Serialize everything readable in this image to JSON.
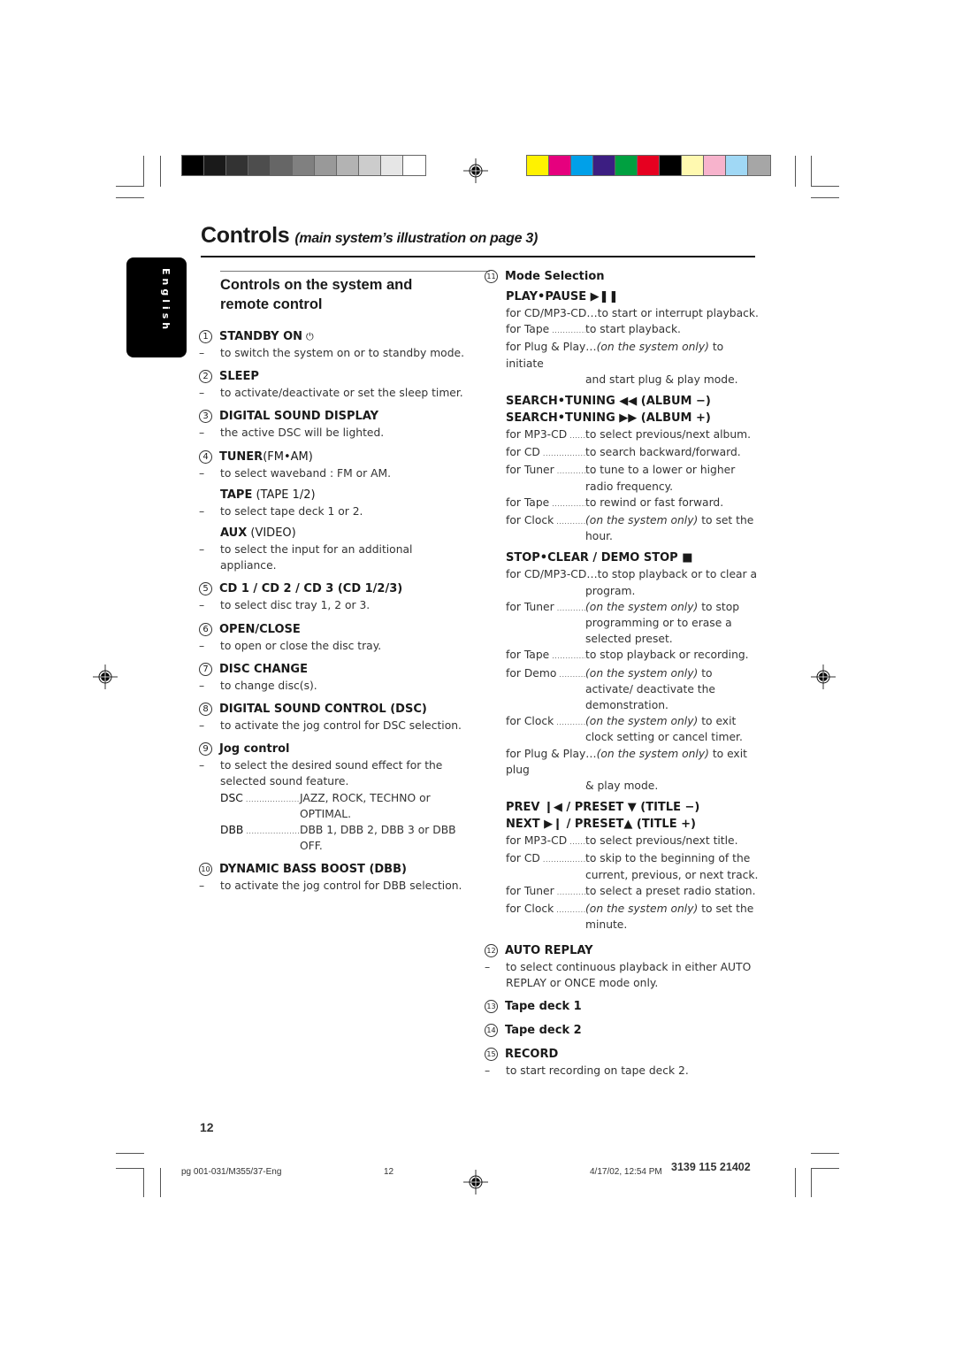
{
  "print_marks": {
    "grayscale": [
      "#000000",
      "#1a1a1a",
      "#333333",
      "#4d4d4d",
      "#666666",
      "#808080",
      "#999999",
      "#b3b3b3",
      "#cccccc",
      "#e6e6e6",
      "#ffffff"
    ],
    "colors": [
      "#fff200",
      "#e6007e",
      "#00a0e9",
      "#3c1e82",
      "#00a040",
      "#e60020",
      "#000000",
      "#fff9b0",
      "#f7b3cc",
      "#a0d8f5",
      "#a6a6a6"
    ]
  },
  "header": {
    "title": "Controls",
    "subtitle": "(main system’s illustration on page 3)",
    "language_tab": "English"
  },
  "left": {
    "section_title_line1": "Controls on the system and",
    "section_title_line2": "remote control",
    "items": [
      {
        "num": "1",
        "label": "STANDBY ON",
        "icon": "power-icon",
        "desc": "to switch the system on or to standby mode."
      },
      {
        "num": "2",
        "label": "SLEEP",
        "desc": "to activate/deactivate or set the sleep timer."
      },
      {
        "num": "3",
        "label": "DIGITAL SOUND DISPLAY",
        "desc": "the active DSC will be lighted."
      },
      {
        "num": "4",
        "label": "TUNER",
        "paren": "(FM•AM)",
        "desc": "to select waveband : FM or AM.",
        "extra": [
          {
            "label": "TAPE",
            "paren": "(TAPE 1/2)",
            "desc": "to select tape deck 1 or 2."
          },
          {
            "label": "AUX",
            "paren": "(VIDEO)",
            "desc": "to select the input for an additional appliance."
          }
        ]
      },
      {
        "num": "5",
        "label": "CD 1 / CD 2 / CD 3 (CD 1/2/3)",
        "desc": "to select disc tray 1, 2 or 3."
      },
      {
        "num": "6",
        "label": "OPEN/CLOSE",
        "desc": "to open or close the disc tray."
      },
      {
        "num": "7",
        "label": "DISC CHANGE",
        "desc": "to change disc(s)."
      },
      {
        "num": "8",
        "label": "DIGITAL SOUND CONTROL (DSC)",
        "desc": "to activate the jog control for DSC selection."
      },
      {
        "num": "9",
        "label": "Jog control",
        "desc": "to select the desired sound effect for the selected sound feature.",
        "rows": [
          {
            "k": "DSC",
            "v": "JAZZ, ROCK, TECHNO or OPTIMAL."
          },
          {
            "k": "DBB",
            "v": "DBB 1, DBB 2, DBB 3 or DBB OFF."
          }
        ]
      },
      {
        "num": "10",
        "label": "DYNAMIC BASS BOOST (DBB)",
        "desc": "to activate the jog control for DBB selection."
      }
    ]
  },
  "right": {
    "item11": {
      "num": "11",
      "label": "Mode Selection",
      "groups": [
        {
          "heads": [
            "PLAY•PAUSE ▶❚❚"
          ],
          "rows": [
            {
              "full": "for CD/MP3-CD…to start or interrupt playback."
            },
            {
              "k": "for Tape",
              "v": "to start playback."
            },
            {
              "full": "for Plug & Play…",
              "it": "(on the system only)",
              "rest": " to initiate",
              "cont": "and start plug & play mode."
            }
          ]
        },
        {
          "heads": [
            "SEARCH•TUNING ◀◀ (ALBUM −)",
            "SEARCH•TUNING ▶▶ (ALBUM +)"
          ],
          "rows": [
            {
              "k": "for MP3-CD",
              "v": "to select previous/next album."
            },
            {
              "k": "for CD",
              "v": "to search backward/forward."
            },
            {
              "k": "for Tuner",
              "v": "to tune to a lower or higher radio frequency."
            },
            {
              "k": "for Tape",
              "v": "to rewind or fast forward."
            },
            {
              "k": "for Clock",
              "it": "(on the system only)",
              "v": " to set the hour."
            }
          ]
        },
        {
          "heads": [
            "STOP•CLEAR / DEMO STOP ■"
          ],
          "rows": [
            {
              "full": "for CD/MP3-CD…to stop playback or to clear a",
              "cont": "program."
            },
            {
              "k": "for Tuner",
              "it": "(on the system only)",
              "v": " to stop programming or to erase a selected preset."
            },
            {
              "k": "for Tape",
              "v": "to stop playback or recording."
            },
            {
              "k": "for Demo",
              "it": "(on the system only)",
              "v": " to activate/ deactivate the demonstration."
            },
            {
              "k": "for Clock",
              "it": "(on the system only)",
              "v": " to exit clock setting or cancel timer."
            },
            {
              "full": "for Plug & Play…",
              "it": "(on the system only)",
              "rest": " to exit plug",
              "cont": "& play mode."
            }
          ]
        },
        {
          "heads": [
            "PREV ❙◀ / PRESET ▼ (TITLE −)",
            "NEXT ▶❙ / PRESET▲ (TITLE +)"
          ],
          "rows": [
            {
              "k": "for MP3-CD",
              "v": "to select previous/next title."
            },
            {
              "k": "for CD",
              "v": "to skip to the beginning of the current, previous, or next track."
            },
            {
              "k": "for Tuner",
              "v": "to select a preset radio station."
            },
            {
              "k": "for Clock",
              "it": "(on the system only)",
              "v": " to set the minute."
            }
          ]
        }
      ]
    },
    "items": [
      {
        "num": "12",
        "label": "AUTO REPLAY",
        "desc": "to select continuous playback in either AUTO REPLAY or ONCE mode only."
      },
      {
        "num": "13",
        "label": "Tape deck 1"
      },
      {
        "num": "14",
        "label": "Tape deck 2"
      },
      {
        "num": "15",
        "label": "RECORD",
        "desc": "to start recording on tape deck 2."
      }
    ]
  },
  "footer": {
    "page_number": "12",
    "slug_file": "pg 001-031/M355/37-Eng",
    "slug_page": "12",
    "slug_datetime": "4/17/02, 12:54 PM",
    "slug_code": "3139 115 21402"
  }
}
